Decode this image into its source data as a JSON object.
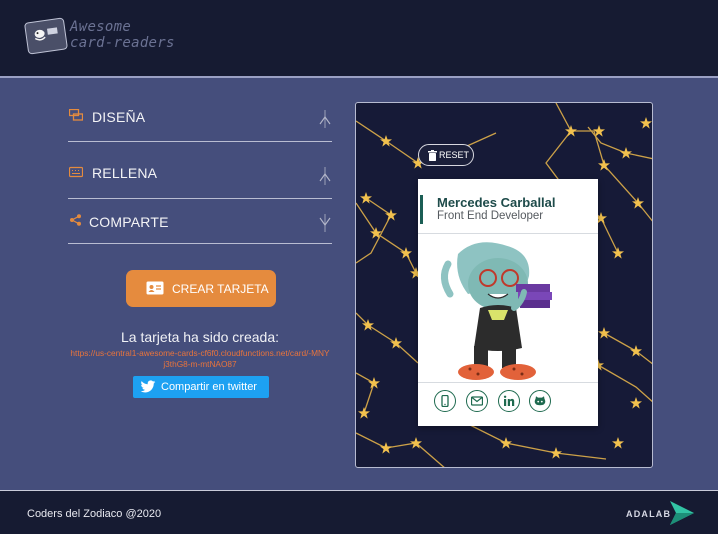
{
  "header": {
    "logo_line1": "Awesome",
    "logo_line2": "card-readers",
    "logo_icon": "card-reader-icon"
  },
  "form": {
    "sections": [
      {
        "label": "DISEÑA",
        "icon": "paint-icon",
        "arrow": "chevron-up-icon"
      },
      {
        "label": "RELLENA",
        "icon": "keyboard-icon",
        "arrow": "chevron-up-icon"
      },
      {
        "label": "COMPARTE",
        "icon": "share-icon",
        "arrow": "chevron-down-icon"
      }
    ],
    "create_button": {
      "label": "CREAR TARJETA",
      "icon": "id-card-icon"
    },
    "created_title": "La tarjeta ha sido creada:",
    "created_link": "https://us-central1-awesome-cards-cf6f0.cloudfunctions.net/card/-MNYj3thG8-m-mtNAO87",
    "twitter_button": {
      "label": "Compartir en twitter",
      "icon": "twitter-icon"
    }
  },
  "preview": {
    "reset_label": "RESET",
    "reset_icon": "trash-icon",
    "card": {
      "name": "Mercedes Carballal",
      "job": "Front End Developer",
      "social": [
        "phone-icon",
        "mail-icon",
        "linkedin-icon",
        "github-icon"
      ]
    }
  },
  "footer": {
    "text": "Coders del Zodiaco @2020",
    "brand": "ADALAB"
  },
  "colors": {
    "header_bg": "#161b32",
    "page_bg": "#454e7c",
    "accent_orange": "#e58b3e",
    "link_orange": "#e9743c",
    "twitter_blue": "#1da1f2",
    "card_name": "#1e4b4a",
    "social_green": "#1e6a4f",
    "star_gold": "#f2c14e"
  }
}
